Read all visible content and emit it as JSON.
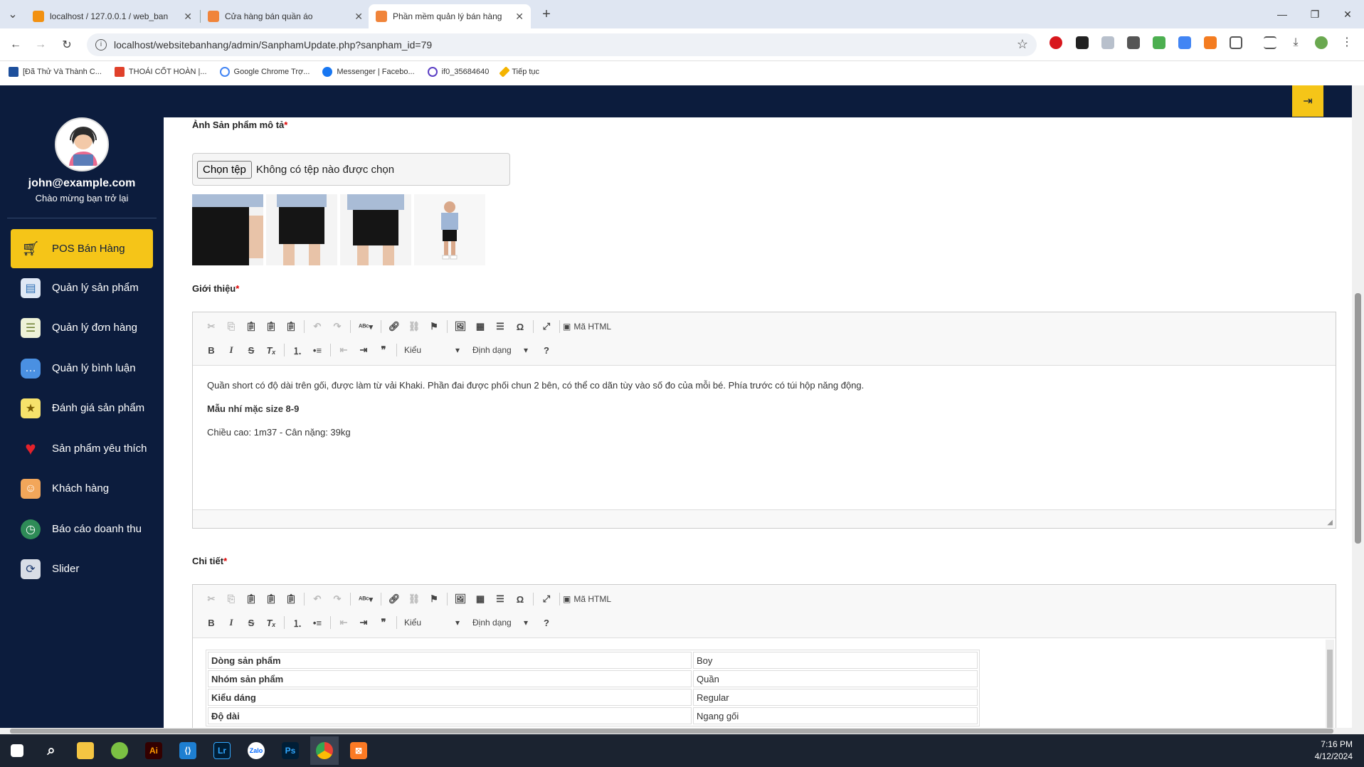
{
  "browser": {
    "tabs": [
      {
        "title": "localhost / 127.0.0.1 / web_ban",
        "active": false
      },
      {
        "title": "Cửa hàng bán quần áo",
        "active": false
      },
      {
        "title": "Phần mềm quản lý bán hàng",
        "active": true
      }
    ],
    "url": "localhost/websitebanhang/admin/SanphamUpdate.php?sanpham_id=79",
    "bookmarks": [
      "[Đã Thử Và Thành C...",
      "THOÁI CỐT HOÀN |...",
      "Google Chrome Trợ...",
      "Messenger | Facebo...",
      "if0_35684640",
      "Tiếp tục"
    ]
  },
  "user": {
    "email": "john@example.com",
    "welcome": "Chào mừng bạn trở lại"
  },
  "sidebar": {
    "items": [
      {
        "label": "POS Bán Hàng",
        "icon": "cart-icon",
        "active": true
      },
      {
        "label": "Quản lý sản phẩm",
        "icon": "product-icon",
        "active": false
      },
      {
        "label": "Quản lý đơn hàng",
        "icon": "order-icon",
        "active": false
      },
      {
        "label": "Quản lý bình luận",
        "icon": "comment-icon",
        "active": false
      },
      {
        "label": "Đánh giá sản phẩm",
        "icon": "rating-icon",
        "active": false
      },
      {
        "label": "Sản phẩm yêu thích",
        "icon": "heart-icon",
        "active": false
      },
      {
        "label": "Khách hàng",
        "icon": "customer-icon",
        "active": false
      },
      {
        "label": "Báo cáo doanh thu",
        "icon": "clock-icon",
        "active": false
      },
      {
        "label": "Slider",
        "icon": "slider-icon",
        "active": false
      }
    ]
  },
  "form": {
    "image_label": "Ảnh Sản phẩm mô tả",
    "file_button": "Chọn tệp",
    "file_status": "Không có tệp nào được chọn",
    "intro_label": "Giới thiệu",
    "detail_label": "Chi tiết",
    "required_mark": "*"
  },
  "editor": {
    "html_button": "Mã HTML",
    "style_combo": "Kiểu",
    "format_combo": "Định dạng",
    "help": "?"
  },
  "intro": {
    "p1": "Quần short có độ dài trên gối, được làm từ vải Khaki. Phần đai được phối chun 2 bên, có thể co dãn tùy vào số đo của mỗi bé. Phía trước có túi hộp năng động.",
    "p2": "Mẫu nhí mặc size 8-9",
    "p3": "Chiều cao: 1m37 - Cân nặng: 39kg"
  },
  "detail_table": [
    {
      "key": "Dòng sản phẩm",
      "value": "Boy"
    },
    {
      "key": "Nhóm sản phẩm",
      "value": "Quần"
    },
    {
      "key": "Kiểu dáng",
      "value": "Regular"
    },
    {
      "key": "Độ dài",
      "value": "Ngang gối"
    }
  ],
  "clock": {
    "time": "7:16 PM",
    "date": "4/12/2024"
  },
  "colors": {
    "navy": "#0c1c3d",
    "accent": "#f5c518"
  }
}
